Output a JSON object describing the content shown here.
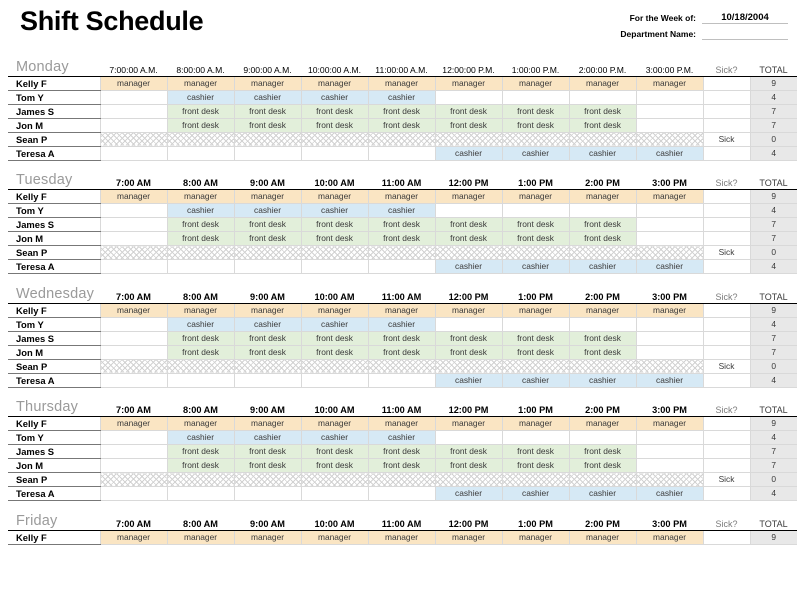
{
  "header": {
    "title": "Shift Schedule",
    "week_label": "For the Week of:",
    "week_value": "10/18/2004",
    "department_label": "Department Name:",
    "department_value": ""
  },
  "columns": {
    "sick_header": "Sick?",
    "total_header": "TOTAL",
    "times_long": [
      "7:00:00 A.M.",
      "8:00:00 A.M.",
      "9:00:00 A.M.",
      "10:00:00 A.M.",
      "11:00:00 A.M.",
      "12:00:00 P.M.",
      "1:00:00 P.M.",
      "2:00:00 P.M.",
      "3:00:00 P.M."
    ],
    "times_short": [
      "7:00 AM",
      "8:00 AM",
      "9:00 AM",
      "10:00 AM",
      "11:00 AM",
      "12:00 PM",
      "1:00 PM",
      "2:00 PM",
      "3:00 PM"
    ]
  },
  "shift_colors": {
    "manager": "#fae5c3",
    "cashier": "#d6e9f5",
    "front desk": "#e2efda",
    "total": "#e8e8e8"
  },
  "days": [
    {
      "name": "Monday",
      "time_format": "long",
      "times": [
        "7:00:00 A.M.",
        "8:00:00 A.M.",
        "9:00:00 A.M.",
        "10:00:00 A.M.",
        "11:00:00 A.M.",
        "12:00:00 P.M.",
        "1:00:00 P.M.",
        "2:00:00 P.M.",
        "3:00:00 P.M."
      ],
      "rows": [
        {
          "name": "Kelly F",
          "shifts": [
            "manager",
            "manager",
            "manager",
            "manager",
            "manager",
            "manager",
            "manager",
            "manager",
            "manager"
          ],
          "sick": "",
          "total": "9",
          "hatched": false
        },
        {
          "name": "Tom Y",
          "shifts": [
            "",
            "cashier",
            "cashier",
            "cashier",
            "cashier",
            "",
            "",
            "",
            ""
          ],
          "sick": "",
          "total": "4",
          "hatched": false
        },
        {
          "name": "James S",
          "shifts": [
            "",
            "front desk",
            "front desk",
            "front desk",
            "front desk",
            "front desk",
            "front desk",
            "front desk",
            ""
          ],
          "sick": "",
          "total": "7",
          "hatched": false
        },
        {
          "name": "Jon M",
          "shifts": [
            "",
            "front desk",
            "front desk",
            "front desk",
            "front desk",
            "front desk",
            "front desk",
            "front desk",
            ""
          ],
          "sick": "",
          "total": "7",
          "hatched": false
        },
        {
          "name": "Sean P",
          "shifts": [
            "",
            "",
            "",
            "",
            "",
            "",
            "",
            "",
            ""
          ],
          "sick": "Sick",
          "total": "0",
          "hatched": true
        },
        {
          "name": "Teresa A",
          "shifts": [
            "",
            "",
            "",
            "",
            "",
            "cashier",
            "cashier",
            "cashier",
            "cashier"
          ],
          "sick": "",
          "total": "4",
          "hatched": false
        }
      ]
    },
    {
      "name": "Tuesday",
      "time_format": "short",
      "times": [
        "7:00 AM",
        "8:00 AM",
        "9:00 AM",
        "10:00 AM",
        "11:00 AM",
        "12:00 PM",
        "1:00 PM",
        "2:00 PM",
        "3:00 PM"
      ],
      "rows": [
        {
          "name": "Kelly F",
          "shifts": [
            "manager",
            "manager",
            "manager",
            "manager",
            "manager",
            "manager",
            "manager",
            "manager",
            "manager"
          ],
          "sick": "",
          "total": "9",
          "hatched": false
        },
        {
          "name": "Tom Y",
          "shifts": [
            "",
            "cashier",
            "cashier",
            "cashier",
            "cashier",
            "",
            "",
            "",
            ""
          ],
          "sick": "",
          "total": "4",
          "hatched": false
        },
        {
          "name": "James S",
          "shifts": [
            "",
            "front desk",
            "front desk",
            "front desk",
            "front desk",
            "front desk",
            "front desk",
            "front desk",
            ""
          ],
          "sick": "",
          "total": "7",
          "hatched": false
        },
        {
          "name": "Jon M",
          "shifts": [
            "",
            "front desk",
            "front desk",
            "front desk",
            "front desk",
            "front desk",
            "front desk",
            "front desk",
            ""
          ],
          "sick": "",
          "total": "7",
          "hatched": false
        },
        {
          "name": "Sean P",
          "shifts": [
            "",
            "",
            "",
            "",
            "",
            "",
            "",
            "",
            ""
          ],
          "sick": "Sick",
          "total": "0",
          "hatched": true
        },
        {
          "name": "Teresa A",
          "shifts": [
            "",
            "",
            "",
            "",
            "",
            "cashier",
            "cashier",
            "cashier",
            "cashier"
          ],
          "sick": "",
          "total": "4",
          "hatched": false
        }
      ]
    },
    {
      "name": "Wednesday",
      "time_format": "short",
      "times": [
        "7:00 AM",
        "8:00 AM",
        "9:00 AM",
        "10:00 AM",
        "11:00 AM",
        "12:00 PM",
        "1:00 PM",
        "2:00 PM",
        "3:00 PM"
      ],
      "rows": [
        {
          "name": "Kelly F",
          "shifts": [
            "manager",
            "manager",
            "manager",
            "manager",
            "manager",
            "manager",
            "manager",
            "manager",
            "manager"
          ],
          "sick": "",
          "total": "9",
          "hatched": false
        },
        {
          "name": "Tom Y",
          "shifts": [
            "",
            "cashier",
            "cashier",
            "cashier",
            "cashier",
            "",
            "",
            "",
            ""
          ],
          "sick": "",
          "total": "4",
          "hatched": false
        },
        {
          "name": "James S",
          "shifts": [
            "",
            "front desk",
            "front desk",
            "front desk",
            "front desk",
            "front desk",
            "front desk",
            "front desk",
            ""
          ],
          "sick": "",
          "total": "7",
          "hatched": false
        },
        {
          "name": "Jon M",
          "shifts": [
            "",
            "front desk",
            "front desk",
            "front desk",
            "front desk",
            "front desk",
            "front desk",
            "front desk",
            ""
          ],
          "sick": "",
          "total": "7",
          "hatched": false
        },
        {
          "name": "Sean P",
          "shifts": [
            "",
            "",
            "",
            "",
            "",
            "",
            "",
            "",
            ""
          ],
          "sick": "Sick",
          "total": "0",
          "hatched": true
        },
        {
          "name": "Teresa A",
          "shifts": [
            "",
            "",
            "",
            "",
            "",
            "cashier",
            "cashier",
            "cashier",
            "cashier"
          ],
          "sick": "",
          "total": "4",
          "hatched": false
        }
      ]
    },
    {
      "name": "Thursday",
      "time_format": "short",
      "times": [
        "7:00 AM",
        "8:00 AM",
        "9:00 AM",
        "10:00 AM",
        "11:00 AM",
        "12:00 PM",
        "1:00 PM",
        "2:00 PM",
        "3:00 PM"
      ],
      "rows": [
        {
          "name": "Kelly F",
          "shifts": [
            "manager",
            "manager",
            "manager",
            "manager",
            "manager",
            "manager",
            "manager",
            "manager",
            "manager"
          ],
          "sick": "",
          "total": "9",
          "hatched": false
        },
        {
          "name": "Tom Y",
          "shifts": [
            "",
            "cashier",
            "cashier",
            "cashier",
            "cashier",
            "",
            "",
            "",
            ""
          ],
          "sick": "",
          "total": "4",
          "hatched": false
        },
        {
          "name": "James S",
          "shifts": [
            "",
            "front desk",
            "front desk",
            "front desk",
            "front desk",
            "front desk",
            "front desk",
            "front desk",
            ""
          ],
          "sick": "",
          "total": "7",
          "hatched": false
        },
        {
          "name": "Jon M",
          "shifts": [
            "",
            "front desk",
            "front desk",
            "front desk",
            "front desk",
            "front desk",
            "front desk",
            "front desk",
            ""
          ],
          "sick": "",
          "total": "7",
          "hatched": false
        },
        {
          "name": "Sean P",
          "shifts": [
            "",
            "",
            "",
            "",
            "",
            "",
            "",
            "",
            ""
          ],
          "sick": "Sick",
          "total": "0",
          "hatched": true
        },
        {
          "name": "Teresa A",
          "shifts": [
            "",
            "",
            "",
            "",
            "",
            "cashier",
            "cashier",
            "cashier",
            "cashier"
          ],
          "sick": "",
          "total": "4",
          "hatched": false
        }
      ]
    },
    {
      "name": "Friday",
      "time_format": "short",
      "times": [
        "7:00 AM",
        "8:00 AM",
        "9:00 AM",
        "10:00 AM",
        "11:00 AM",
        "12:00 PM",
        "1:00 PM",
        "2:00 PM",
        "3:00 PM"
      ],
      "rows": [
        {
          "name": "Kelly F",
          "shifts": [
            "manager",
            "manager",
            "manager",
            "manager",
            "manager",
            "manager",
            "manager",
            "manager",
            "manager"
          ],
          "sick": "",
          "total": "9",
          "hatched": false
        }
      ]
    }
  ]
}
